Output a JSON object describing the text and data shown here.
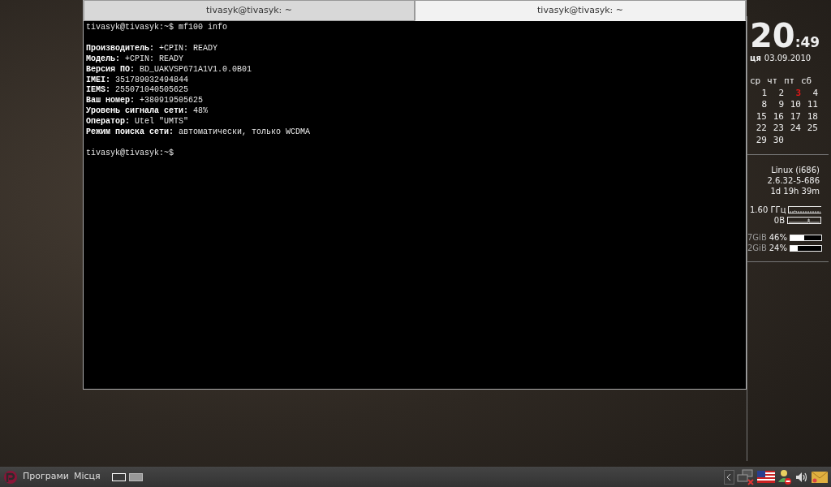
{
  "terminal": {
    "tabs": [
      {
        "label": "tivasyk@tivasyk: ~",
        "selected": false
      },
      {
        "label": "tivasyk@tivasyk: ~",
        "selected": true
      }
    ],
    "command_line": "tivasyk@tivasyk:~$ mf100 info",
    "output": [
      "**Производитель:** +CPIN: READY",
      "**Модель:** +CPIN: READY",
      "**Версия ПО:** BD_UAKVSP671A1V1.0.0B01",
      "**IMEI:** 351789032494844",
      "**IEMS:** 255071040505625",
      "**Ваш номер:** +380919505625",
      "**Уровень сигнала сети:** 48%",
      "**Оператор:** Utel \"UMTS\"",
      "**Режим поиска сети:** автоматически, только WCDMA"
    ],
    "prompt": "tivasyk@tivasyk:~$"
  },
  "conky": {
    "hours": "20",
    "minutes": ":49",
    "weekday": "ця",
    "date": "03.09.2010",
    "calendar": {
      "weekdays": [
        "ср",
        "чт",
        "пт",
        "сб"
      ],
      "weeks": [
        [
          {
            "day": "1",
            "selected": false
          },
          {
            "day": "2",
            "selected": false
          },
          {
            "day": "3",
            "selected": true
          },
          {
            "day": "4",
            "selected": false
          }
        ],
        [
          {
            "day": "8",
            "selected": false
          },
          {
            "day": "9",
            "selected": false
          },
          {
            "day": "10",
            "selected": false
          },
          {
            "day": "11",
            "selected": false
          }
        ],
        [
          {
            "day": "15",
            "selected": false
          },
          {
            "day": "16",
            "selected": false
          },
          {
            "day": "17",
            "selected": false
          },
          {
            "day": "18",
            "selected": false
          }
        ],
        [
          {
            "day": "22",
            "selected": false
          },
          {
            "day": "23",
            "selected": false
          },
          {
            "day": "24",
            "selected": false
          },
          {
            "day": "25",
            "selected": false
          }
        ],
        [
          {
            "day": "29",
            "selected": false
          },
          {
            "day": "30",
            "selected": false
          }
        ]
      ]
    },
    "system": [
      "Linux (i686)",
      "2.6.32-5-686",
      "1d 19h 39m"
    ],
    "graphs": [
      {
        "label": "1.60 ГГц"
      },
      {
        "label": "0B"
      }
    ],
    "memory": [
      {
        "size": "7GiB",
        "percent": "46%",
        "level": 0.46
      },
      {
        "size": "2GiB",
        "percent": "24%",
        "level": 0.24
      }
    ]
  },
  "taskbar": {
    "menus": [
      "Програми",
      "Місця"
    ],
    "workspaces": [
      {
        "selected": true
      },
      {
        "selected": false
      }
    ]
  }
}
